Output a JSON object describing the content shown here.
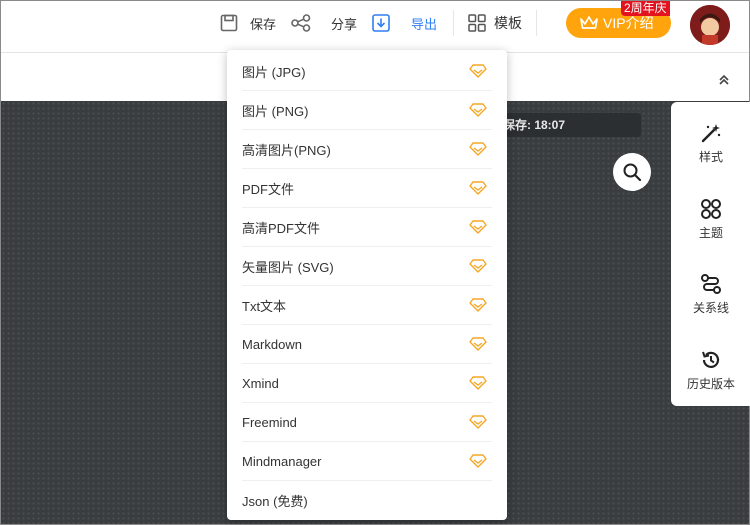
{
  "toolbar": {
    "save_label": "保存",
    "share_label": "分享",
    "export_label": "导出",
    "template_label": "模板"
  },
  "vip": {
    "label": "VIP介绍",
    "badge": "2周年庆"
  },
  "canvas": {
    "save_status": "保存: 18:07"
  },
  "right_panel": {
    "items": [
      {
        "label": "样式",
        "icon": "style-wand-icon"
      },
      {
        "label": "主题",
        "icon": "theme-grid-icon"
      },
      {
        "label": "关系线",
        "icon": "relation-line-icon"
      },
      {
        "label": "历史版本",
        "icon": "history-icon"
      }
    ]
  },
  "export_menu": {
    "items": [
      {
        "label": "图片 (JPG)",
        "vip": true
      },
      {
        "label": "图片 (PNG)",
        "vip": true
      },
      {
        "label": "高清图片(PNG)",
        "vip": true
      },
      {
        "label": "PDF文件",
        "vip": true
      },
      {
        "label": "高清PDF文件",
        "vip": true
      },
      {
        "label": "矢量图片 (SVG)",
        "vip": true
      },
      {
        "label": "Txt文本",
        "vip": true
      },
      {
        "label": "Markdown",
        "vip": true
      },
      {
        "label": "Xmind",
        "vip": true
      },
      {
        "label": "Freemind",
        "vip": true
      },
      {
        "label": "Mindmanager",
        "vip": true
      },
      {
        "label": "Json (免费)",
        "vip": false
      }
    ]
  },
  "colors": {
    "accent_blue": "#2f7ef5",
    "vip_orange": "#ffa40c",
    "badge_red": "#e2131f",
    "canvas_dark": "#393d40"
  }
}
